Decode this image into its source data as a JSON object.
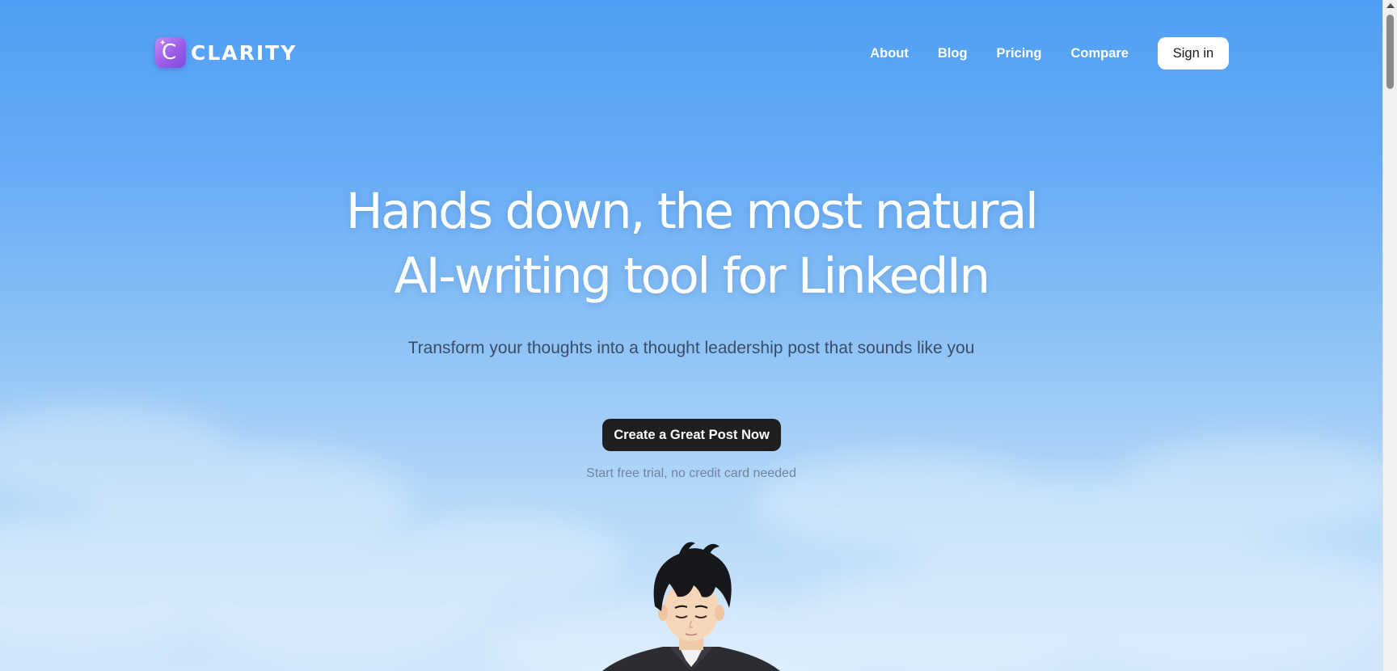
{
  "brand": {
    "name": "CLARITY",
    "logo_letter": "C"
  },
  "nav": {
    "items": [
      {
        "label": "About"
      },
      {
        "label": "Blog"
      },
      {
        "label": "Pricing"
      },
      {
        "label": "Compare"
      }
    ],
    "signin_label": "Sign in"
  },
  "hero": {
    "title_line1": "Hands down, the most natural",
    "title_line2": "AI-writing tool for LinkedIn",
    "subtitle": "Transform your thoughts into a thought leadership post that sounds like you",
    "cta_label": "Create a Great Post Now",
    "cta_note": "Start free trial, no credit card needed"
  },
  "colors": {
    "sky_top": "#4f9ef5",
    "sky_bottom": "#cfe6fb",
    "cta_bg": "#201f1f",
    "logo_gradient_start": "#c78cf2",
    "logo_gradient_end": "#7d4be0"
  },
  "icons": {
    "logo": "sparkle-c-logo-icon",
    "illustration": "anime-man-in-suit-illustration"
  }
}
